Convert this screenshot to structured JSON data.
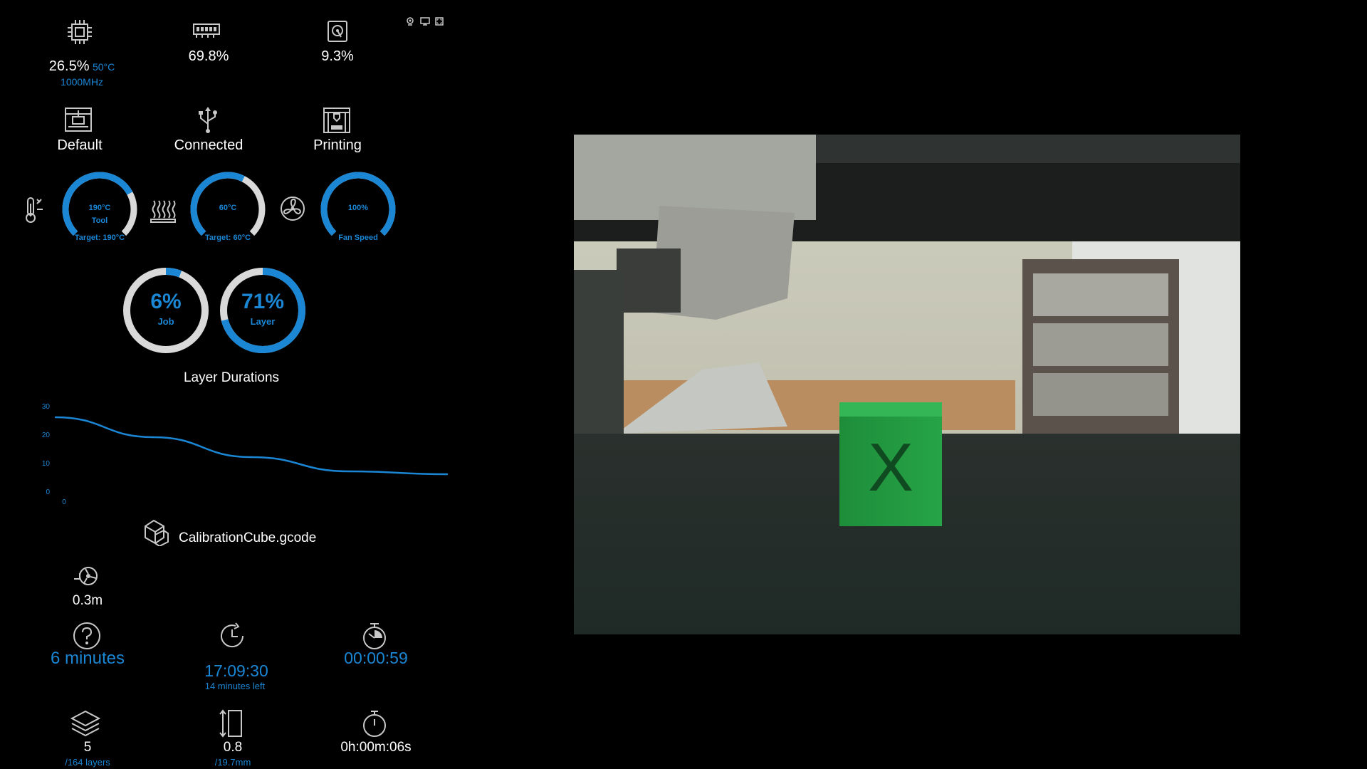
{
  "system": {
    "cpu": {
      "usage": "26.5%",
      "temp": "50°C",
      "freq": "1000MHz",
      "icon": "cpu-icon"
    },
    "memory": {
      "usage": "69.8%",
      "icon": "memory-icon"
    },
    "disk": {
      "usage": "9.3%",
      "icon": "disk-icon"
    }
  },
  "window_controls": [
    {
      "icon": "webcam-toggle-icon"
    },
    {
      "icon": "display-icon"
    },
    {
      "icon": "fullscreen-icon"
    }
  ],
  "status": {
    "profile": {
      "label": "Default",
      "icon": "printer-profile-icon"
    },
    "connection": {
      "label": "Connected",
      "icon": "usb-icon"
    },
    "state": {
      "label": "Printing",
      "icon": "printer-state-icon"
    }
  },
  "gauges": {
    "tool": {
      "value": "190°C",
      "name": "Tool",
      "target": "Target: 190°C",
      "fraction": 0.73,
      "icon": "hotend-thermometer-icon"
    },
    "bed": {
      "value": "60°C",
      "target": "Target: 60°C",
      "fraction": 0.6,
      "icon": "heated-bed-icon"
    },
    "fan": {
      "value": "100%",
      "name": "Fan Speed",
      "fraction": 1.0,
      "icon": "fan-icon"
    }
  },
  "progress": {
    "job": {
      "value": "6%",
      "label": "Job",
      "fraction": 0.06
    },
    "layer": {
      "value": "71%",
      "label": "Layer",
      "fraction": 0.71
    }
  },
  "layer_durations_title": "Layer Durations",
  "chart_data": {
    "type": "line",
    "title": "Layer Durations",
    "x": [
      0,
      1,
      2,
      3,
      4
    ],
    "series": [
      {
        "values": [
          26,
          19,
          12,
          7,
          6
        ]
      }
    ],
    "yticks": [
      "30",
      "20",
      "10",
      "0"
    ],
    "xticks": [
      "0"
    ],
    "ylim": [
      0,
      30
    ],
    "color": "#1a86d4"
  },
  "file": {
    "name": "CalibrationCube.gcode",
    "icon": "file-cube-icon"
  },
  "filament": {
    "value": "0.3m",
    "icon": "filament-spool-icon"
  },
  "times": {
    "estimate": {
      "value": "6 minutes",
      "icon": "question-circle-icon"
    },
    "eta": {
      "value": "17:09:30",
      "sub": "14 minutes left",
      "icon": "clock-forward-icon"
    },
    "elapsed": {
      "value": "00:00:59",
      "icon": "timer-icon"
    }
  },
  "bottom": {
    "layers": {
      "value": "5",
      "sub": "/164 layers",
      "icon": "layers-icon"
    },
    "height": {
      "value": "0.8",
      "sub": "/19.7mm",
      "icon": "height-icon"
    },
    "layer_time": {
      "value": "0h:00m:06s",
      "icon": "stopwatch-icon"
    }
  },
  "colors": {
    "accent": "#1a86d4",
    "track": "#d9d9d9",
    "background": "#000000"
  }
}
